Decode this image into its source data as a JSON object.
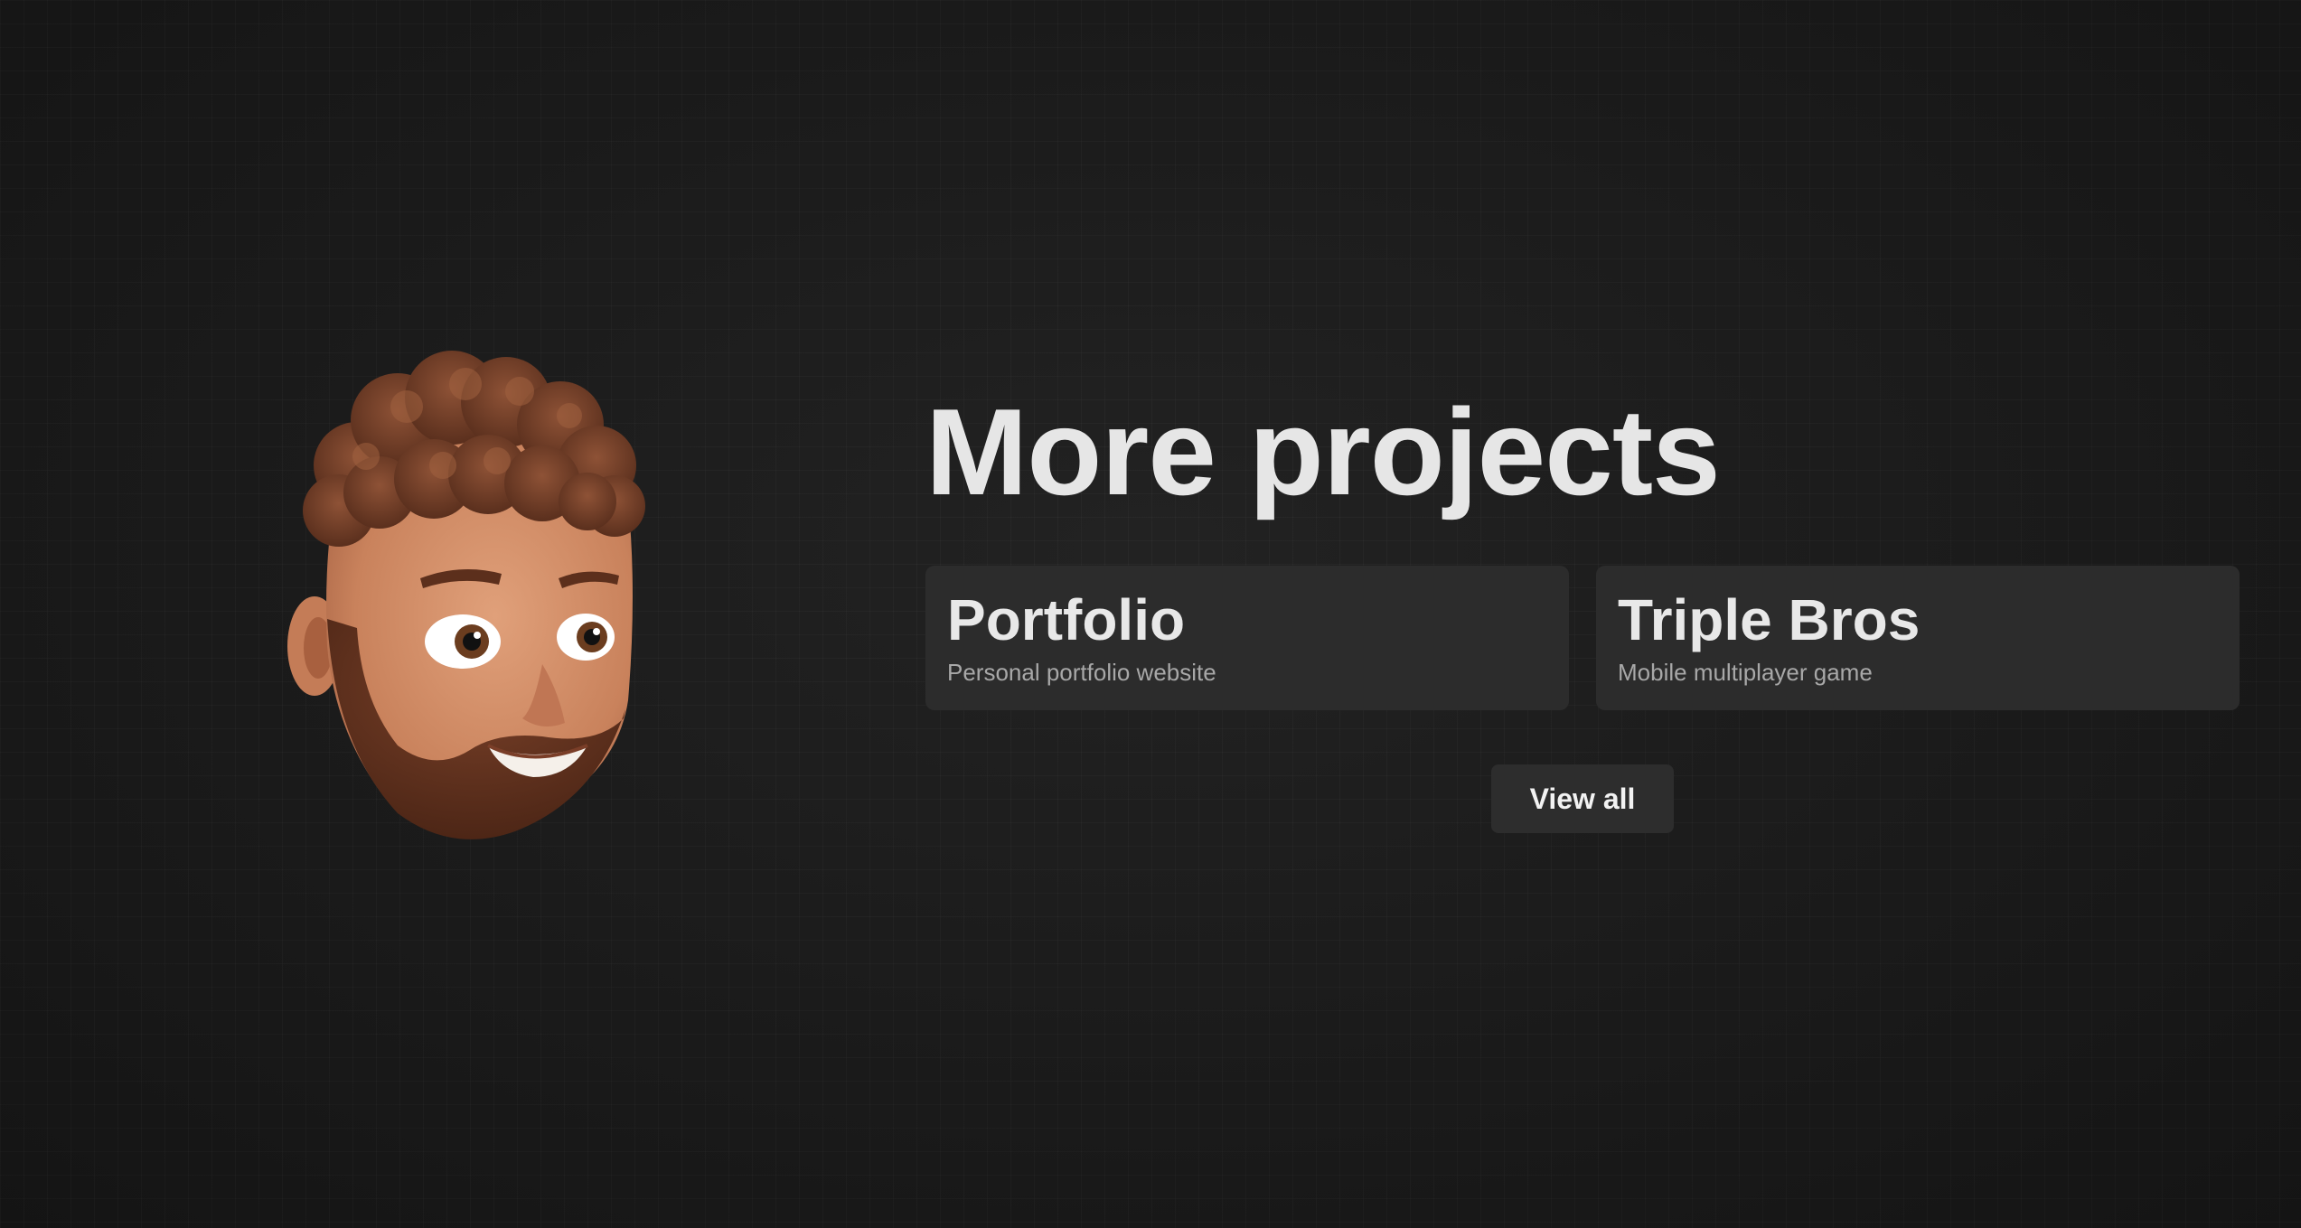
{
  "section": {
    "title": "More projects"
  },
  "projects": [
    {
      "title": "Portfolio",
      "subtitle": "Personal portfolio website"
    },
    {
      "title": "Triple Bros",
      "subtitle": "Mobile multiplayer game"
    }
  ],
  "actions": {
    "view_all_label": "View all"
  },
  "avatar": {
    "icon": "memoji-avatar"
  },
  "colors": {
    "background": "#1b1b1b",
    "card": "#2c2c2c",
    "text": "#e6e6e6",
    "subtext": "#a8a8a8"
  }
}
